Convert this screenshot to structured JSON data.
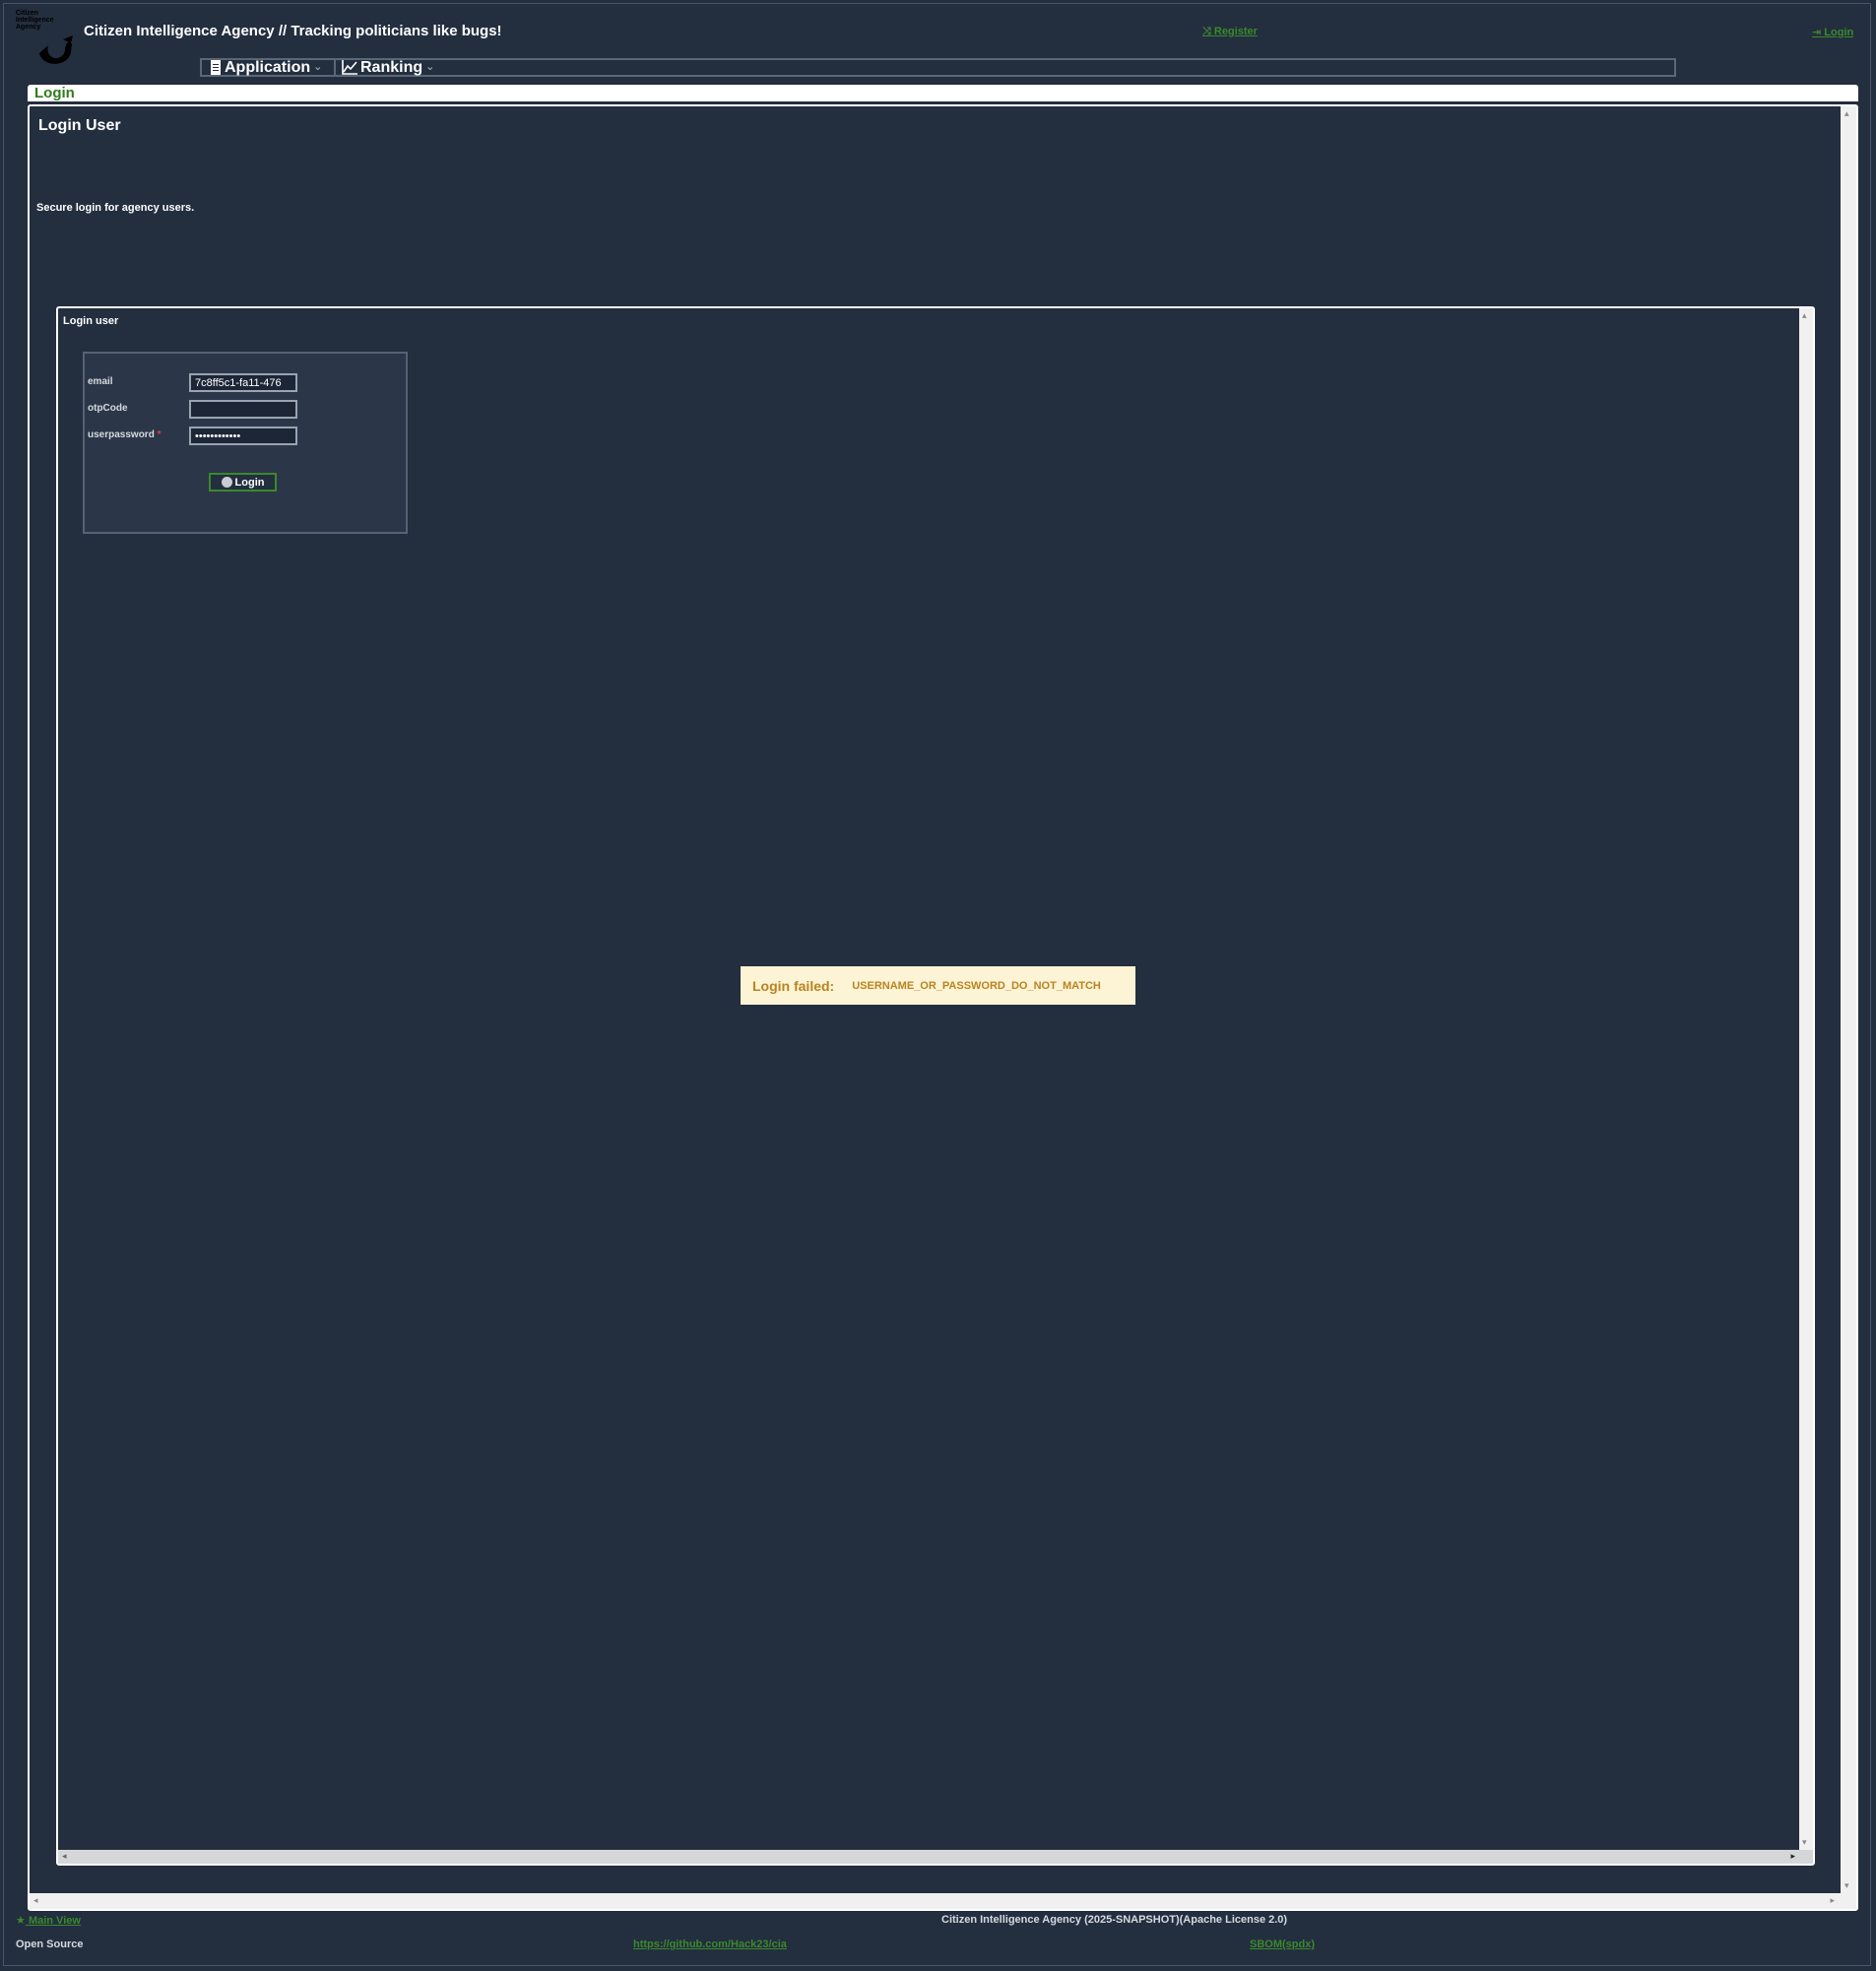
{
  "header": {
    "logo_text": "Citizen\nIntelligence\nAgency",
    "title": "Citizen Intelligence Agency  // Tracking politicians like bugs!",
    "register_label": "Register",
    "login_label": "Login"
  },
  "menu": {
    "items": [
      {
        "label": "Application",
        "icon": "document-icon"
      },
      {
        "label": "Ranking",
        "icon": "chart-line-icon"
      }
    ]
  },
  "panel": {
    "tab_label": "Login",
    "heading": "Login User",
    "description": "Secure login for agency users."
  },
  "form": {
    "section_title": "Login user",
    "email_label": "email",
    "email_value": "7c8ff5c1-fa11-476",
    "otp_label": "otpCode",
    "otp_value": "",
    "password_label": "userpassword",
    "password_required_mark": "*",
    "password_value": "••••••••••••",
    "submit_label": "Login"
  },
  "notification": {
    "caption": "Login failed:",
    "message": "USERNAME_OR_PASSWORD_DO_NOT_MATCH"
  },
  "footer": {
    "main_view_label": "Main View",
    "version_text": "Citizen Intelligence Agency (2025-SNAPSHOT)(Apache License 2.0)",
    "open_source_label": "Open Source",
    "github_link": "https://github.com/Hack23/cia",
    "sbom_link": "SBOM(spdx)"
  },
  "colors": {
    "background": "#232e3f",
    "link_green": "#3a8a2a",
    "notice_bg": "#fdf3d5",
    "notice_text": "#b88420"
  }
}
